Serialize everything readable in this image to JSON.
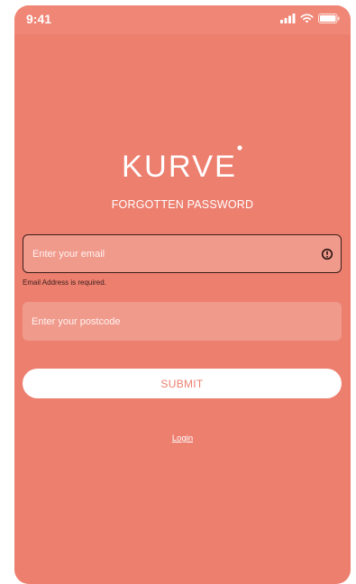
{
  "status_bar": {
    "time": "9:41",
    "icons": [
      "cellular-signal-icon",
      "wifi-icon",
      "battery-icon"
    ]
  },
  "logo": {
    "text": "KURVE"
  },
  "page": {
    "subtitle": "FORGOTTEN PASSWORD"
  },
  "form": {
    "email": {
      "placeholder": "Enter your email",
      "value": "",
      "error": "Email Address is required.",
      "error_icon": "alert-circle-icon"
    },
    "postcode": {
      "placeholder": "Enter your postcode",
      "value": ""
    },
    "submit_label": "SUBMIT"
  },
  "links": {
    "login": "Login"
  },
  "colors": {
    "background": "#ed7f6f",
    "field_fill": "#f09a8c",
    "button_fill": "#ffffff",
    "button_text": "#ed7f6f",
    "error_text": "#3a1e1a"
  }
}
